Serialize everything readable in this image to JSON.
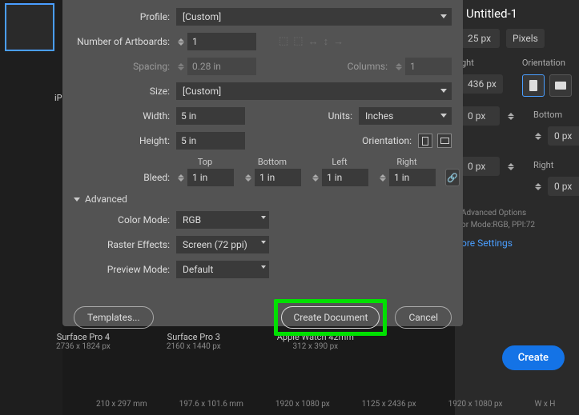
{
  "background": {
    "title": "Untitled-1",
    "width_val": "25 px",
    "units": "Pixels",
    "height_label": "ght",
    "height_val": "436 px",
    "orientation_label": "Orientation",
    "bottom_label": "Bottom",
    "right_label": "Right",
    "zero_px": "0 px",
    "adv_options": "Advanced Options",
    "mode_info": "or Mode:RGB, PPI:72",
    "more_settings": "ore Settings",
    "create": "Create"
  },
  "left": {
    "ip": "iP"
  },
  "thumbs": [
    {
      "name": "Surface Pro 4",
      "dim": "2736 x 1824 px"
    },
    {
      "name": "Surface Pro 3",
      "dim": "2160 x 1440 px"
    },
    {
      "name": "Apple Watch 42mm",
      "dim": "312 x 390 px"
    }
  ],
  "cats": [
    "210 x 297 mm",
    "197.6 x 101.6 mm",
    "1920 x 1080 px",
    "1125 x 2436 px",
    "1920 x 1080 px",
    "W x H"
  ],
  "dialog": {
    "profile_label": "Profile:",
    "profile": "[Custom]",
    "artboards_label": "Number of Artboards:",
    "artboards": "1",
    "spacing_label": "Spacing:",
    "spacing": "0.28 in",
    "columns_label": "Columns:",
    "columns": "1",
    "size_label": "Size:",
    "size": "[Custom]",
    "width_label": "Width:",
    "width": "5 in",
    "units_label": "Units:",
    "units": "Inches",
    "height_label": "Height:",
    "height": "5 in",
    "orientation_label": "Orientation:",
    "bleed_label": "Bleed:",
    "bleed": {
      "top": "Top",
      "bottom": "Bottom",
      "left": "Left",
      "right": "Right",
      "val": "1 in"
    },
    "advanced": "Advanced",
    "color_mode_label": "Color Mode:",
    "color_mode": "RGB",
    "raster_label": "Raster Effects:",
    "raster": "Screen (72 ppi)",
    "preview_label": "Preview Mode:",
    "preview": "Default",
    "templates": "Templates...",
    "create_doc": "Create Document",
    "cancel": "Cancel"
  }
}
